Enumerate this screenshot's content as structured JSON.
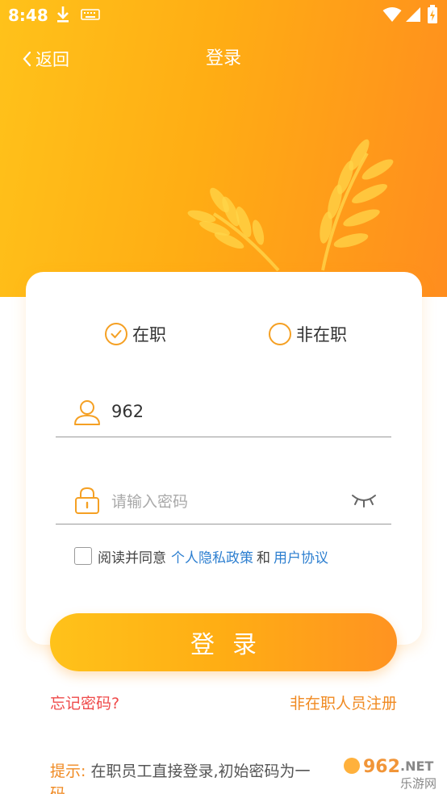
{
  "status_bar": {
    "time": "8:48"
  },
  "nav": {
    "back_label": "返回",
    "title": "登录"
  },
  "employment": {
    "option_employed": "在职",
    "option_not_employed": "非在职",
    "selected": "在职"
  },
  "form": {
    "username_value": "962",
    "password_placeholder": "请输入密码"
  },
  "agreement": {
    "prefix": "阅读并同意",
    "privacy_link": "个人隐私政策",
    "conjunction": "和",
    "terms_link": "用户协议",
    "checked": false
  },
  "actions": {
    "login_label": "登录",
    "forgot_label": "忘记密码?",
    "register_label": "非在职人员注册"
  },
  "tip": {
    "label": "提示:",
    "text": " 在职员工直接登录,初始密码为一",
    "text_wrap": "码"
  },
  "watermark": {
    "brand": "962",
    "suffix": ".NET",
    "sub": "乐游网"
  },
  "colors": {
    "primary_orange": "#ffad14",
    "accent_orange": "#f5a023",
    "link_blue": "#2d7fd0",
    "warning_red": "#ef4a4a"
  }
}
